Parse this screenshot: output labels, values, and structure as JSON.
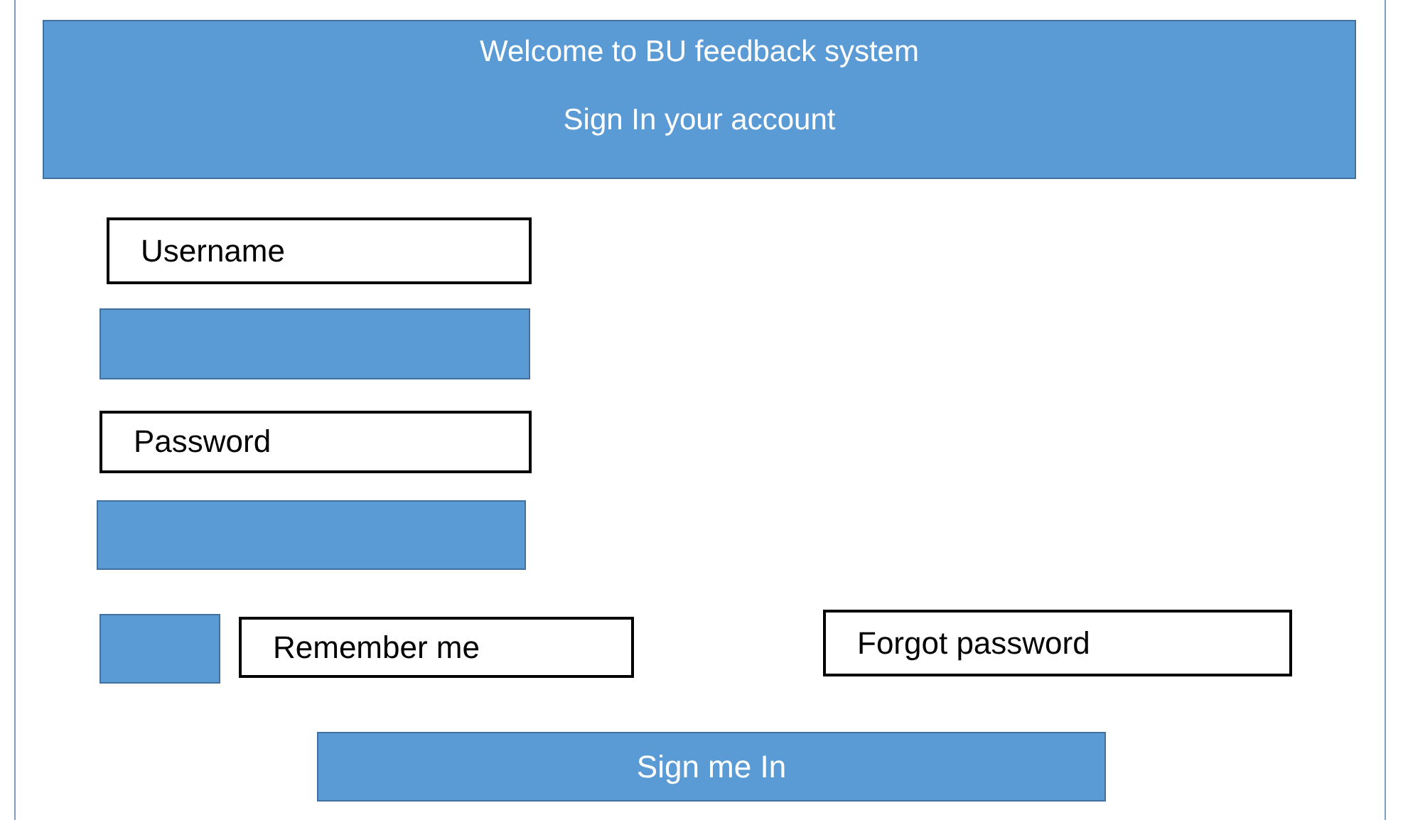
{
  "header": {
    "title": "Welcome to BU feedback system",
    "subtitle": "Sign In your account"
  },
  "username": {
    "label": "Username"
  },
  "password": {
    "label": "Password"
  },
  "remember": {
    "label": "Remember me",
    "checked": false
  },
  "forgot": {
    "label": "Forgot password"
  },
  "submit": {
    "label": "Sign me In"
  }
}
